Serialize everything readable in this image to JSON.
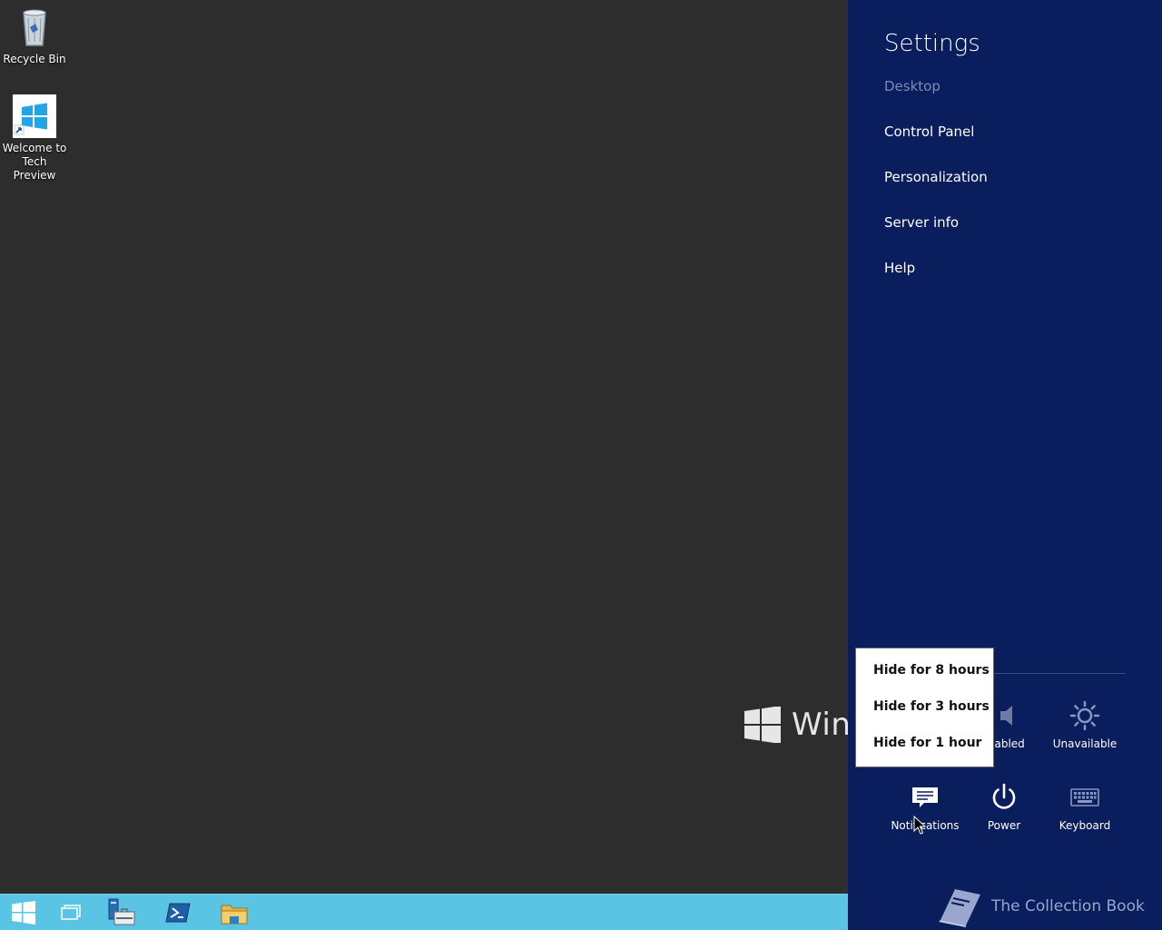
{
  "desktop": {
    "icons": [
      {
        "label": "Recycle Bin"
      },
      {
        "label": "Welcome to Tech Preview"
      }
    ],
    "watermark": "Wind"
  },
  "taskbar": {
    "buttons": [
      {
        "icon": "windows-start-icon"
      },
      {
        "icon": "task-view-icon"
      },
      {
        "icon": "server-manager-icon"
      },
      {
        "icon": "powershell-icon"
      },
      {
        "icon": "file-explorer-icon"
      }
    ],
    "color": "#5ac4e4"
  },
  "charm": {
    "title": "Settings",
    "items": [
      "Desktop",
      "Control Panel",
      "Personalization",
      "Server info",
      "Help"
    ],
    "tiles": {
      "volume": "sabled",
      "brightness": "Unavailable",
      "notifications": "Notifications",
      "power": "Power",
      "keyboard": "Keyboard"
    },
    "brand": "The Collection Book",
    "background": "#0a1d5c"
  },
  "popup": {
    "items": [
      "Hide for 8 hours",
      "Hide for 3 hours",
      "Hide for 1 hour"
    ]
  }
}
